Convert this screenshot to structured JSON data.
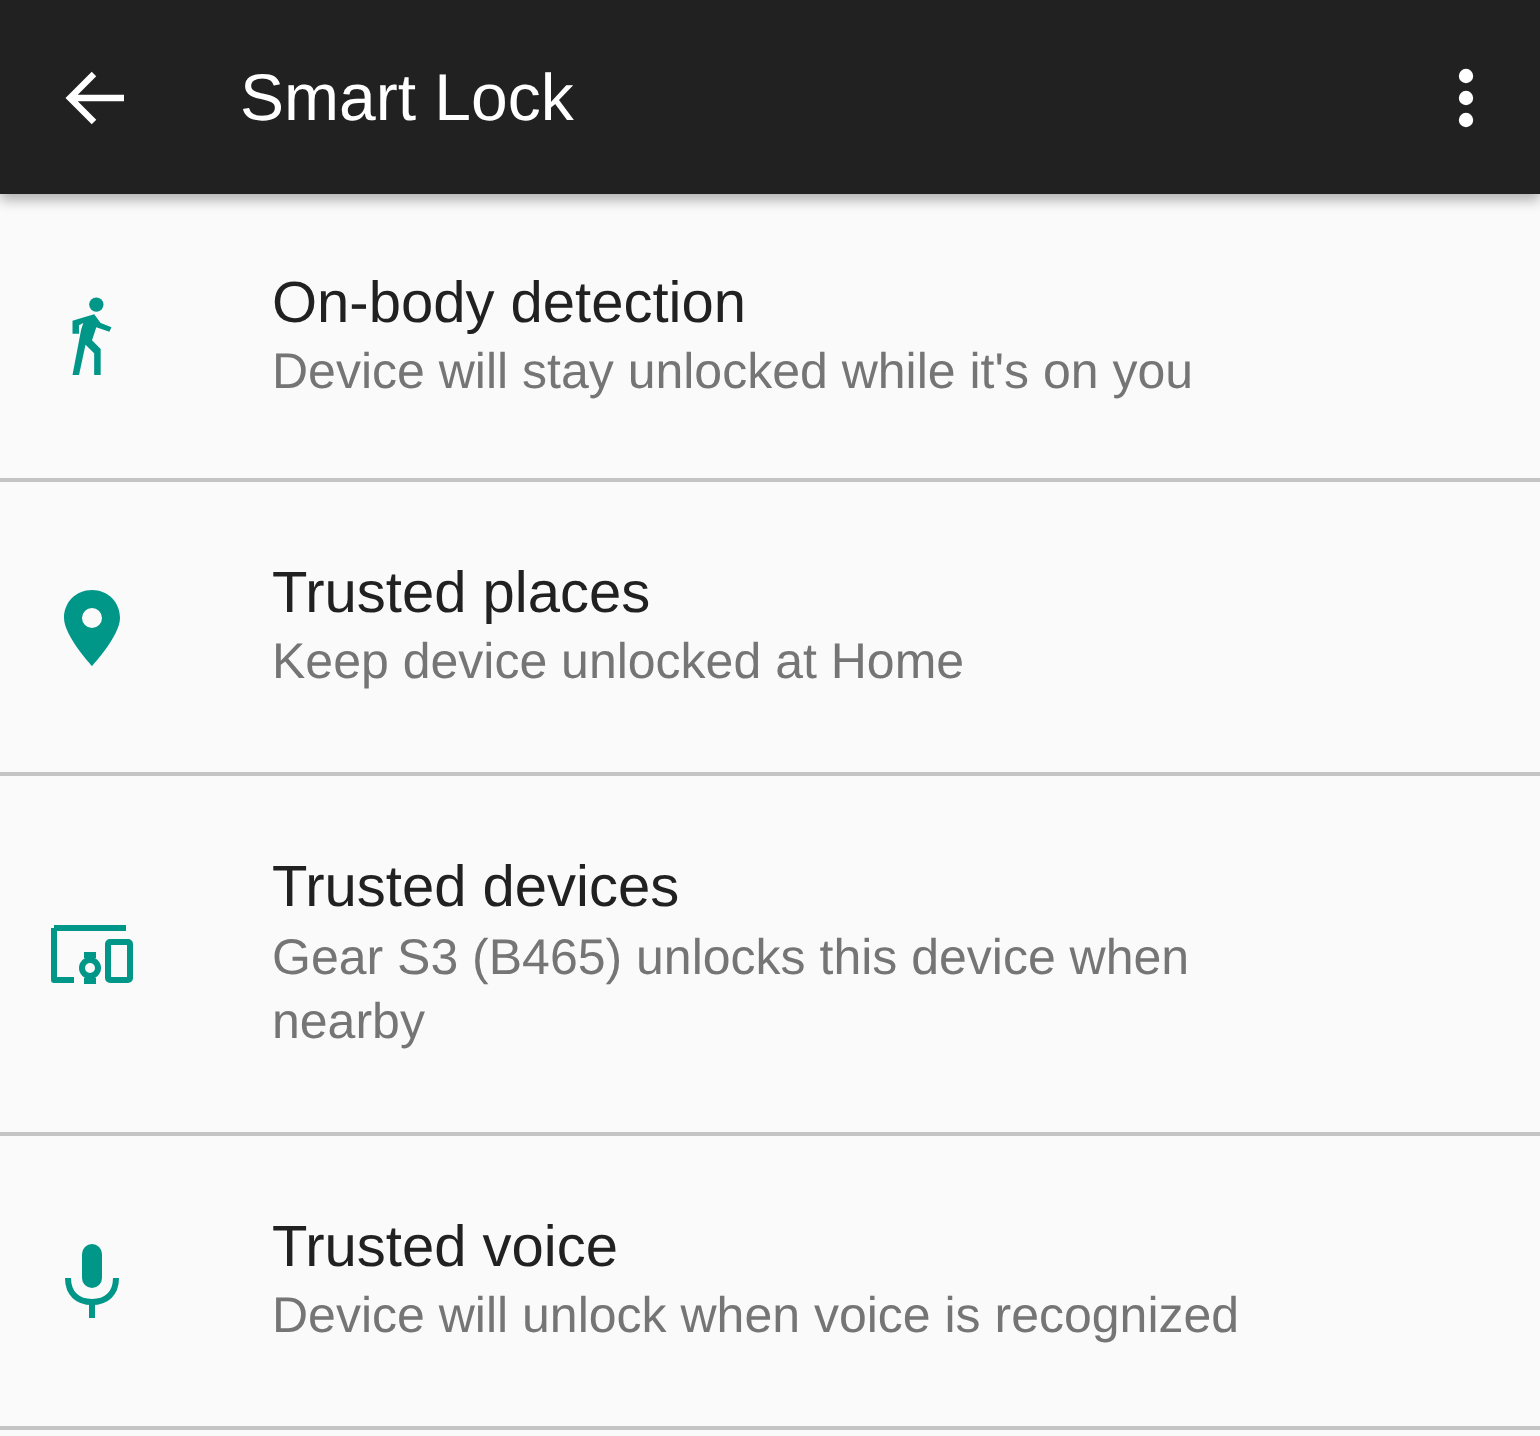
{
  "app_bar": {
    "title": "Smart Lock"
  },
  "items": [
    {
      "kind": "walk",
      "title": "On-body detection",
      "summary": "Device will stay unlocked while it's on you"
    },
    {
      "kind": "place",
      "title": "Trusted places",
      "summary": "Keep device unlocked at Home"
    },
    {
      "kind": "devices",
      "title": "Trusted devices",
      "summary": "Gear S3 (B465) unlocks this device when nearby"
    },
    {
      "kind": "voice",
      "title": "Trusted voice",
      "summary": "Device will unlock when voice is recognized"
    }
  ]
}
